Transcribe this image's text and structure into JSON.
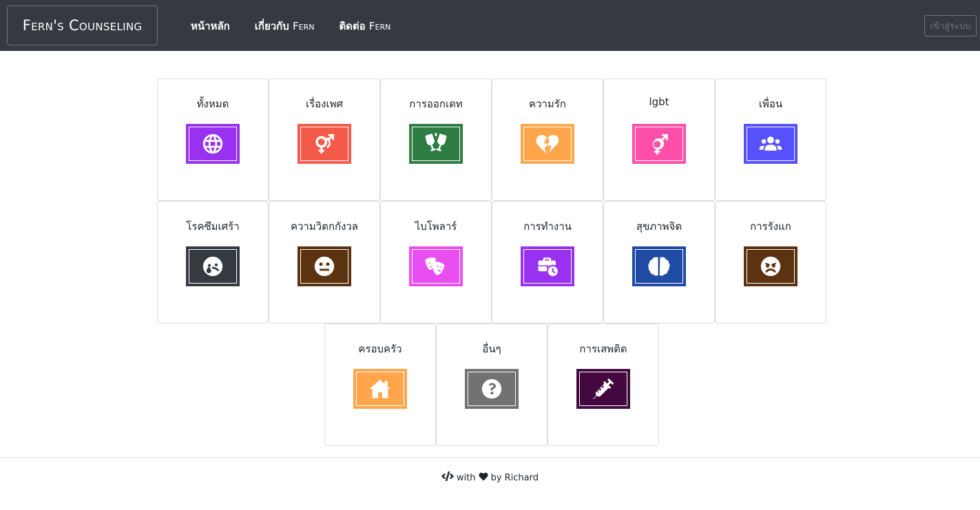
{
  "navbar": {
    "brand": "Fern's Counseling",
    "links": [
      {
        "label": "หน้าหลัก",
        "suffix": ""
      },
      {
        "label": "เกี่ยวกับ ",
        "suffix": "Fern"
      },
      {
        "label": "ติดต่อ ",
        "suffix": "Fern"
      }
    ],
    "login_label": "เข้าสู่ระบบ"
  },
  "categories": [
    {
      "label": "ทั้งหมด",
      "icon": "globe-icon",
      "color": "#9932f0"
    },
    {
      "label": "เรื่องเพศ",
      "icon": "venus-mars-icon",
      "color": "#f45a4a"
    },
    {
      "label": "การออกเดท",
      "icon": "glass-cheers-icon",
      "color": "#2e7d45"
    },
    {
      "label": "ความรัก",
      "icon": "heart-broken-icon",
      "color": "#ffa64d"
    },
    {
      "label": "lgbt",
      "icon": "transgender-icon",
      "color": "#ff4fa8"
    },
    {
      "label": "เพื่อน",
      "icon": "users-icon",
      "color": "#5551ff"
    },
    {
      "label": "โรคซึมเศร้า",
      "icon": "sad-tear-icon",
      "color": "#343a40"
    },
    {
      "label": "ความวิตกกังวล",
      "icon": "meh-icon",
      "color": "#5c3311"
    },
    {
      "label": "ไบโพลาร์",
      "icon": "theater-masks-icon",
      "color": "#e84ef0"
    },
    {
      "label": "การทำงาน",
      "icon": "business-time-icon",
      "color": "#9932f0"
    },
    {
      "label": "สุขภาพจิต",
      "icon": "brain-icon",
      "color": "#1f4ba5"
    },
    {
      "label": "การรังแก",
      "icon": "angry-icon",
      "color": "#5c3311"
    },
    {
      "label": "ครอบครัว",
      "icon": "home-icon",
      "color": "#ffa64d"
    },
    {
      "label": "อื่นๆ",
      "icon": "question-circle-icon",
      "color": "#727272"
    },
    {
      "label": "การเสพติด",
      "icon": "syringe-icon",
      "color": "#43093f"
    }
  ],
  "footer": {
    "with": "with",
    "by": "by Richard"
  }
}
